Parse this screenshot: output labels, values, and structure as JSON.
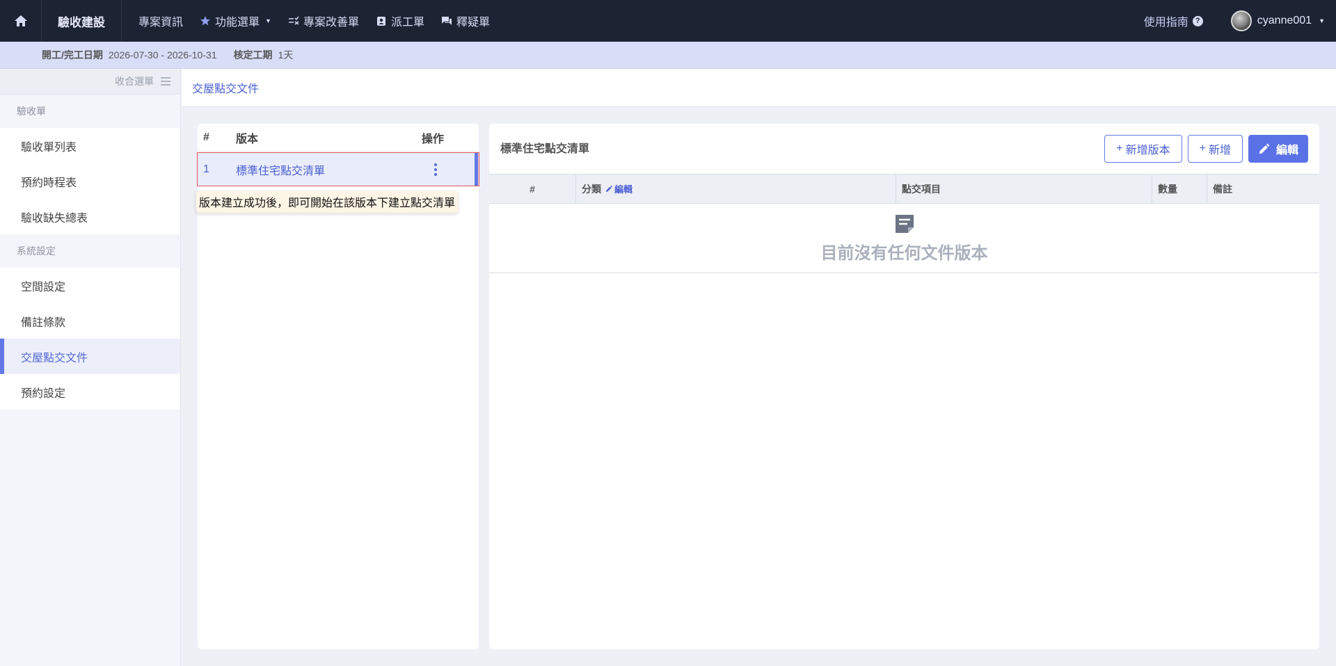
{
  "topbar": {
    "brand": "驗收建設",
    "nav": [
      {
        "label": "專案資訊",
        "icon": "none"
      },
      {
        "label": "功能選單",
        "icon": "star-icon"
      },
      {
        "label": "專案改善單",
        "icon": "checklist-icon"
      },
      {
        "label": "派工單",
        "icon": "badge-icon"
      },
      {
        "label": "釋疑單",
        "icon": "chat-icon"
      }
    ],
    "guide": "使用指南",
    "username": "cyanne001"
  },
  "infobar": {
    "date_label": "開工/完工日期",
    "date_value": "2026-07-30 - 2026-10-31",
    "duration_label": "核定工期",
    "duration_value": "1天"
  },
  "sidebar": {
    "collapse_label": "收合選單",
    "sections": [
      {
        "title": "驗收單",
        "items": [
          "驗收單列表",
          "預約時程表",
          "驗收缺失總表"
        ]
      },
      {
        "title": "系統設定",
        "items": [
          "空間設定",
          "備註條款",
          "交屋點交文件",
          "預約設定"
        ]
      }
    ],
    "active_item": "交屋點交文件"
  },
  "breadcrumb": "交屋點交文件",
  "versions": {
    "headers": {
      "num": "#",
      "version": "版本",
      "action": "操作"
    },
    "rows": [
      {
        "num": "1",
        "name": "標準住宅點交清單"
      }
    ],
    "tooltip": "版本建立成功後，即可開始在該版本下建立點交清單"
  },
  "detail": {
    "title": "標準住宅點交清單",
    "buttons": {
      "add_version": "新增版本",
      "add": "新增",
      "edit": "編輯"
    },
    "table_headers": {
      "num": "#",
      "category": "分類",
      "category_edit": "編輯",
      "item": "點交項目",
      "qty": "數量",
      "note": "備註"
    },
    "empty_text": "目前沒有任何文件版本"
  },
  "colors": {
    "accent": "#5b72e6",
    "topbar": "#1c2434",
    "infobar": "#d9def8"
  }
}
